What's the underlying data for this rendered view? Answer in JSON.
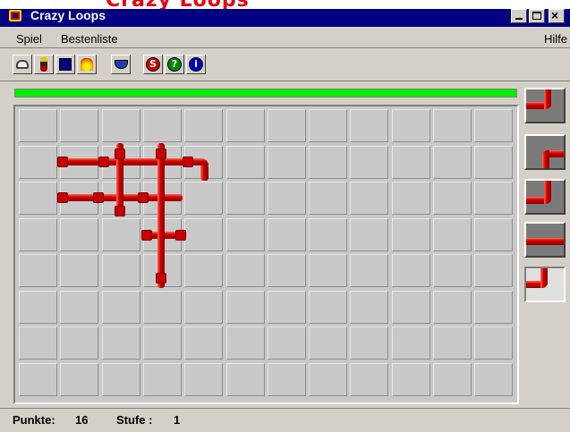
{
  "window": {
    "title": "Crazy Loops",
    "banner_text": "Crazy Loops",
    "close_glyph": "×"
  },
  "menu": {
    "items": [
      "Spiel",
      "Bestenliste",
      "Hilfe"
    ]
  },
  "toolbar": {
    "tools": [
      {
        "icon": "new-game-icon"
      },
      {
        "icon": "player-icon"
      },
      {
        "icon": "save-disk-icon"
      },
      {
        "icon": "fire-icon"
      },
      {
        "icon": "bucket-icon"
      },
      {
        "icon": "stop-icon",
        "glyph": "S",
        "color": "#cc0000"
      },
      {
        "icon": "help-icon",
        "glyph": "?",
        "color": "#008800"
      },
      {
        "icon": "info-icon",
        "glyph": "i",
        "color": "#0000cc"
      }
    ]
  },
  "board": {
    "columns": 12,
    "rows": 8,
    "progress_fraction": 1.0,
    "progress_color": "#00ee00",
    "pipe_color": "#d40000"
  },
  "queue": {
    "pieces": [
      "elbow-up-left",
      "s-bend",
      "elbow-up-left",
      "straight-horizontal",
      "elbow-down-left"
    ]
  },
  "status": {
    "score_label": "Punkte:",
    "score": "16",
    "level_label": "Stufe :",
    "level": "1"
  }
}
